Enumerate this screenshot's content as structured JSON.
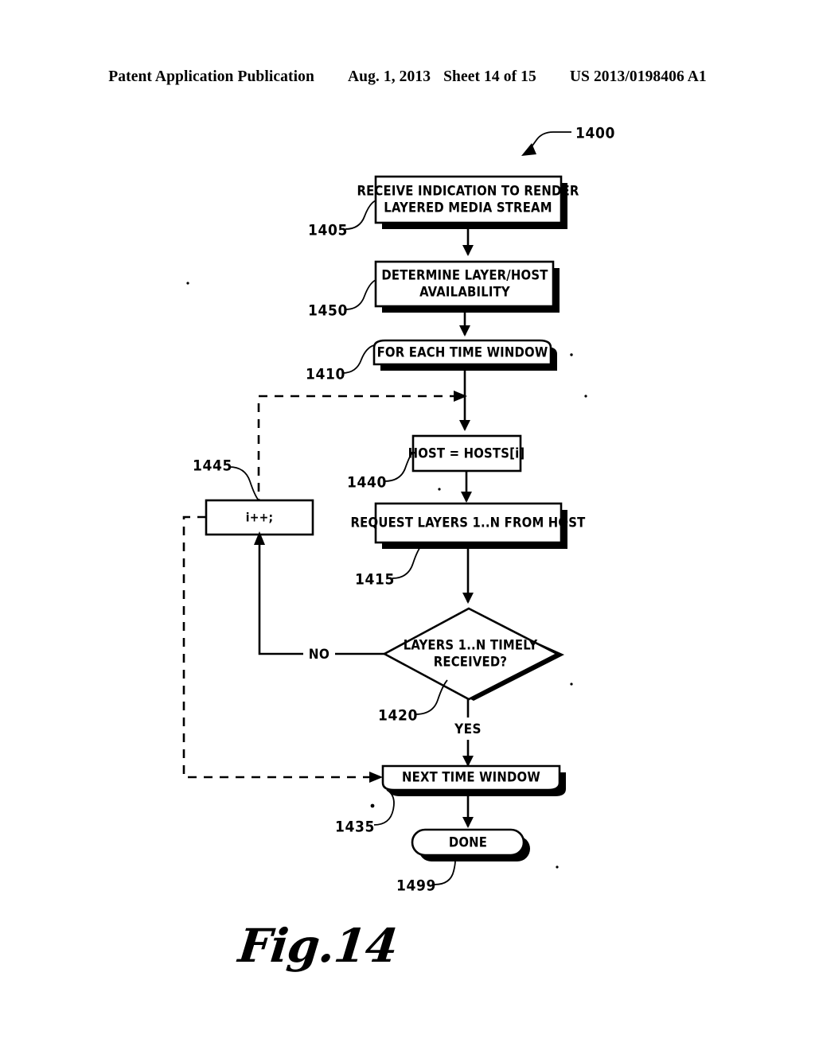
{
  "header": {
    "publication": "Patent Application Publication",
    "date": "Aug. 1, 2013",
    "sheet": "Sheet 14 of 15",
    "patent_number": "US 2013/0198406 A1"
  },
  "figure": {
    "caption": "Fig.14",
    "diagram_ref": "1400",
    "nodes": [
      {
        "ref": "1405",
        "line1": "RECEIVE INDICATION TO RENDER",
        "line2": "LAYERED  MEDIA STREAM",
        "shape": "process-shadow"
      },
      {
        "ref": "1450",
        "line1": "DETERMINE LAYER/HOST",
        "line2": "AVAILABILITY",
        "shape": "process-shadow"
      },
      {
        "ref": "1410",
        "line1": "FOR EACH TIME WINDOW",
        "line2": "",
        "shape": "loop-start-shadow"
      },
      {
        "ref": "1440",
        "line1": "HOST = HOSTS[i]",
        "line2": "",
        "shape": "process-plain"
      },
      {
        "ref": "1415",
        "line1": "REQUEST LAYERS 1..N FROM HOST",
        "line2": "",
        "shape": "process-shadow"
      },
      {
        "ref": "1420",
        "line1": "LAYERS 1..N TIMELY",
        "line2": "RECEIVED?",
        "shape": "decision-shadow"
      },
      {
        "ref": "1445",
        "line1": "i++;",
        "line2": "",
        "shape": "process-plain"
      },
      {
        "ref": "1435",
        "line1": "NEXT TIME WINDOW",
        "line2": "",
        "shape": "loop-end-shadow"
      },
      {
        "ref": "1499",
        "line1": "DONE",
        "line2": "",
        "shape": "terminator-shadow"
      }
    ],
    "branches": {
      "no": "NO",
      "yes": "YES"
    }
  }
}
